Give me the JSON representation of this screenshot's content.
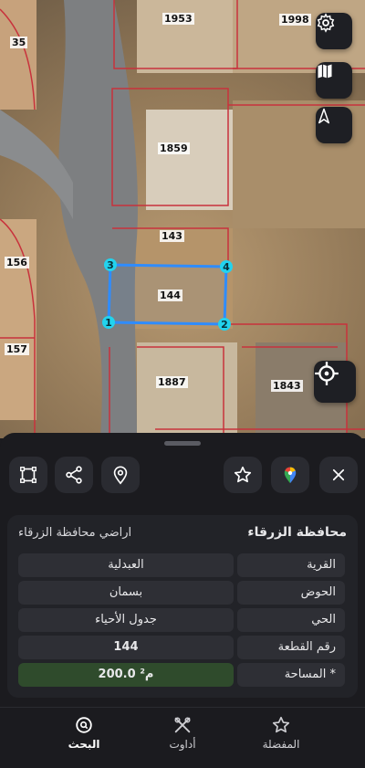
{
  "map": {
    "parcels": [
      "1953",
      "1998",
      "35",
      "1859",
      "143",
      "144",
      "156",
      "157",
      "1887",
      "1843"
    ],
    "vertices": [
      "1",
      "2",
      "3",
      "4"
    ]
  },
  "map_controls": [
    "gear-icon",
    "map-icon",
    "compass-icon",
    "locate-icon"
  ],
  "toolbar": [
    "polygon-icon",
    "share-icon",
    "pin-icon",
    "star-icon",
    "google-maps-icon",
    "close-icon"
  ],
  "info": {
    "title": "محافظة الزرقاء",
    "subtitle": "اراضي محافظة الزرقاء",
    "rows": [
      {
        "label": "القرية",
        "value": "العبدلية"
      },
      {
        "label": "الحوض",
        "value": "بسمان"
      },
      {
        "label": "الحي",
        "value": "جدول الأحياء"
      },
      {
        "label": "رقم القطعة",
        "value": "144"
      },
      {
        "label": "المساحة *",
        "value": "200.0 م²"
      }
    ]
  },
  "nav": {
    "favorites": "المفضلة",
    "tools": "أداوت",
    "search": "البحث"
  },
  "colors": {
    "accent_green": "#2f4b2c",
    "selection_blue": "#2f8cff",
    "vertex_cyan": "#22d3ee",
    "boundary_red": "#c8323c"
  }
}
